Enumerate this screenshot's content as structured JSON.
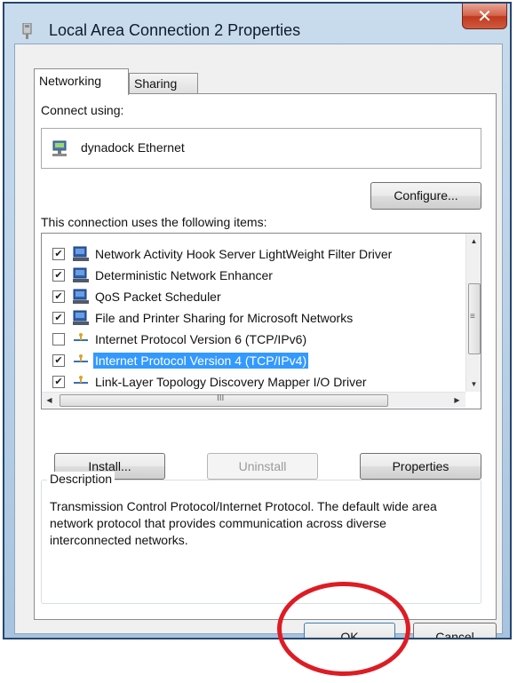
{
  "window": {
    "title": "Local Area Connection 2 Properties",
    "close_label": "✕"
  },
  "tabs": [
    {
      "label": "Networking",
      "active": true
    },
    {
      "label": "Sharing",
      "active": false
    }
  ],
  "connect_using": {
    "label": "Connect using:",
    "adapter": "dynadock Ethernet",
    "configure_label": "Configure..."
  },
  "items_section": {
    "label": "This connection uses the following items:",
    "items": [
      {
        "label": "Network Activity Hook Server LightWeight Filter Driver",
        "checked": true,
        "icon": "network-component-icon",
        "selected": false
      },
      {
        "label": "Deterministic Network Enhancer",
        "checked": true,
        "icon": "network-component-icon",
        "selected": false
      },
      {
        "label": "QoS Packet Scheduler",
        "checked": true,
        "icon": "network-component-icon",
        "selected": false
      },
      {
        "label": "File and Printer Sharing for Microsoft Networks",
        "checked": true,
        "icon": "network-component-icon",
        "selected": false
      },
      {
        "label": "Internet Protocol Version 6 (TCP/IPv6)",
        "checked": false,
        "icon": "protocol-icon",
        "selected": false
      },
      {
        "label": "Internet Protocol Version 4 (TCP/IPv4)",
        "checked": true,
        "icon": "protocol-icon",
        "selected": true
      },
      {
        "label": "Link-Layer Topology Discovery Mapper I/O Driver",
        "checked": true,
        "icon": "protocol-icon",
        "selected": false
      }
    ],
    "hscroll_grip": "III",
    "vscroll_grip": "≡"
  },
  "buttons": {
    "install": "Install...",
    "uninstall": "Uninstall",
    "properties": "Properties",
    "ok": "OK",
    "cancel": "Cancel"
  },
  "description": {
    "legend": "Description",
    "text": "Transmission Control Protocol/Internet Protocol. The default wide area network protocol that provides communication across diverse interconnected networks."
  },
  "colors": {
    "selection": "#3399ff",
    "annotation_ring": "#dd1c24",
    "title_bar": "#b7cfe6"
  }
}
